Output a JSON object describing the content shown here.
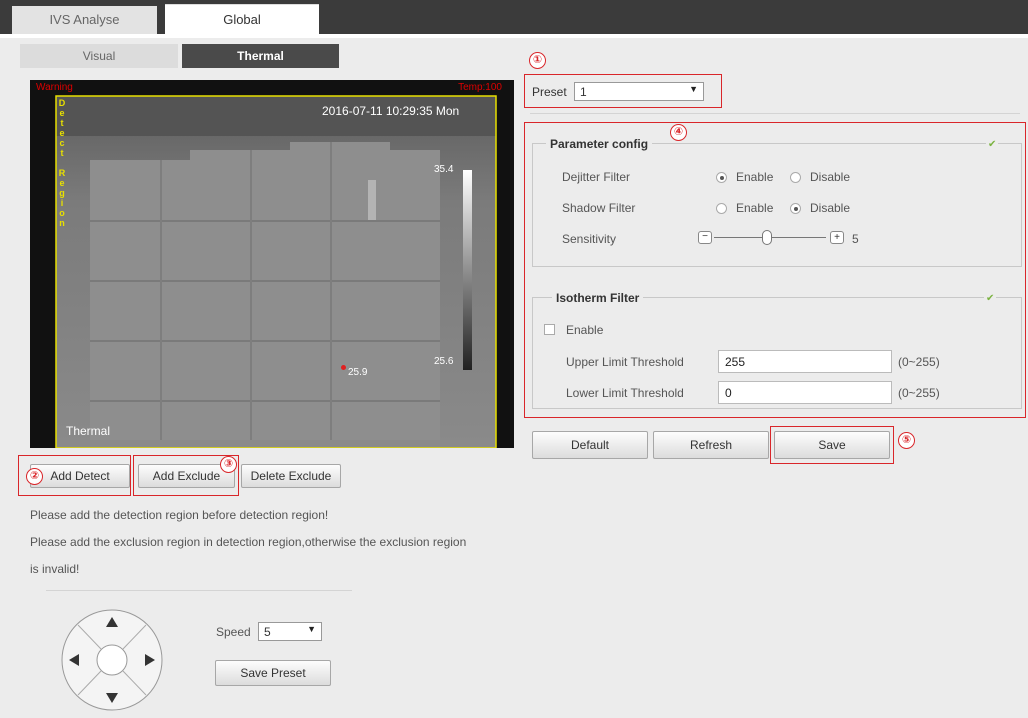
{
  "top_tabs": [
    {
      "label": "IVS Analyse"
    },
    {
      "label": "Global"
    }
  ],
  "sub_tabs": [
    {
      "label": "Visual"
    },
    {
      "label": "Thermal"
    }
  ],
  "video": {
    "red_left": "Warning",
    "red_right": "Temp:100",
    "timestamp": "2016-07-11 10:29:35 Mon",
    "scale_top": "35.4",
    "scale_bottom": "25.6",
    "spot": "25.9",
    "channel": "Thermal",
    "region_label": [
      "D",
      "e",
      "t",
      "e",
      "c",
      "t",
      "",
      "R",
      "e",
      "g",
      "i",
      "o",
      "n"
    ]
  },
  "callouts": [
    "①",
    "②",
    "③",
    "④",
    "⑤"
  ],
  "buttons": {
    "add_detect": "Add Detect",
    "add_exclude": "Add Exclude",
    "delete_exclude": "Delete Exclude",
    "default": "Default",
    "refresh": "Refresh",
    "save": "Save",
    "save_preset": "Save Preset"
  },
  "notes": [
    "Please add the detection region before detection region!",
    "Please add the exclusion region in detection region,otherwise the exclusion region",
    "is invalid!"
  ],
  "preset": {
    "label": "Preset",
    "value": "1"
  },
  "param_config": {
    "title": "Parameter config",
    "dejitter": {
      "label": "Dejitter Filter",
      "enable": "Enable",
      "disable": "Disable",
      "selected": "Enable"
    },
    "shadow": {
      "label": "Shadow Filter",
      "enable": "Enable",
      "disable": "Disable",
      "selected": "Disable"
    },
    "sensitivity": {
      "label": "Sensitivity",
      "value": "5",
      "minus": "−",
      "plus": "+",
      "level": 0.5
    }
  },
  "isotherm": {
    "title": "Isotherm Filter",
    "enable_label": "Enable",
    "enabled": false,
    "upper_label": "Upper Limit Threshold",
    "upper_value": "255",
    "upper_range": "(0~255)",
    "lower_label": "Lower Limit Threshold",
    "lower_value": "0",
    "lower_range": "(0~255)"
  },
  "speed": {
    "label": "Speed",
    "value": "5"
  },
  "colors": {
    "accent_red": "#d9262a",
    "header_dark": "#3b3b3b",
    "active_tab": "#4a4a4a",
    "check_green": "#7cb342"
  }
}
